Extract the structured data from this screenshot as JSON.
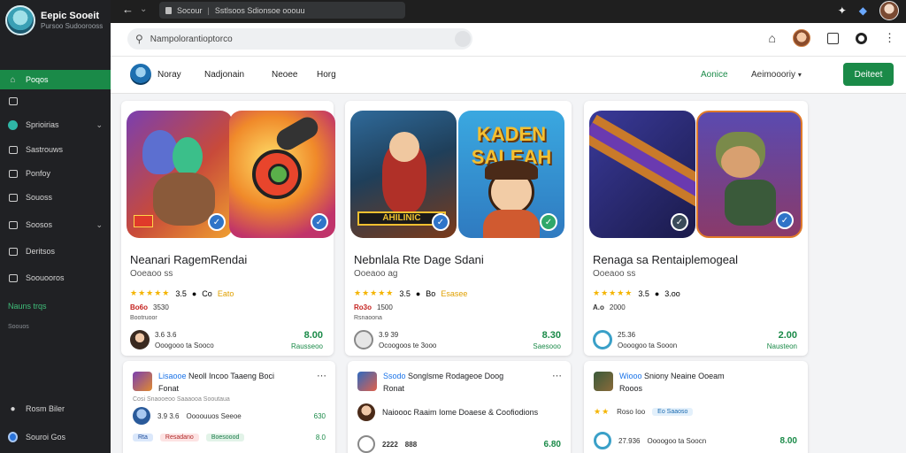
{
  "brand": {
    "title": "Eepic Sooeit",
    "subtitle": "Pursoo Sudoorooss"
  },
  "sidebar": {
    "items": [
      {
        "label": "Poqos",
        "icon": "home-icon"
      },
      {
        "label": "",
        "icon": "inbox-icon"
      },
      {
        "label": "Sprioirias",
        "icon": "globe-icon"
      },
      {
        "label": "Sastrouws",
        "icon": "grid-icon"
      },
      {
        "label": "Ponfoy",
        "icon": "list-icon"
      },
      {
        "label": "Souoss",
        "icon": "window-icon"
      },
      {
        "label": "Soosos",
        "icon": "tray-icon"
      },
      {
        "label": "Deritsos",
        "icon": "folder-icon"
      },
      {
        "label": "Soouooros",
        "icon": "chart-icon"
      },
      {
        "label": "Nauns trqs"
      },
      {
        "label": "Soouos"
      }
    ],
    "bottom": [
      {
        "label": "Rosm Biler",
        "icon": "person-icon"
      },
      {
        "label": "Souroi Gos",
        "icon": "account-icon"
      }
    ]
  },
  "topbar": {
    "tab_label": "Socour",
    "url_text": "Sstlsoos Sdionsoe ooouu"
  },
  "search": {
    "placeholder": "Nampolorantioptorco"
  },
  "tabs": {
    "items": [
      "Noray",
      "Nadjonain",
      "Neoee",
      "Horg"
    ],
    "right_green": "Aonice",
    "right_select": "Aeimoooriy",
    "button": "Deiteet"
  },
  "cards": [
    {
      "title": "Neanari RagemRendai",
      "subtitle": "Ooeaoo ss",
      "rating": "3.5",
      "rating_extra": "Co",
      "rating_tag": "Eato",
      "meta_red": "Bo6o",
      "meta_plain": "3530",
      "meta_small": "Bootruoor",
      "foot_a": "3.6 3.6",
      "foot_b": "Ooogooo ta Sooco",
      "price": "8.00",
      "price_sub": "Rausseoo",
      "art_label": "",
      "colors": {
        "a": "#b24a2e",
        "b": "#e79c2f",
        "icon": "#f7d23c"
      }
    },
    {
      "title": "Nebnlala Rte Dage Sdani",
      "subtitle": "Ooeaoo ag",
      "rating": "3.5",
      "rating_extra": "Bo",
      "rating_tag": "Esasee",
      "meta_red": "Ro3o",
      "meta_plain": "1500",
      "meta_small": "Rsnaoona",
      "foot_a": "3.9 39",
      "foot_b": "Ocoogoos te 3ooo",
      "price": "8.30",
      "price_sub": "Saesooo",
      "art_label": "KADEN SALEAH",
      "art_label_2": "AHILINIC",
      "colors": {
        "a": "#2f78c8",
        "b": "#e8c34a",
        "icon": "#e04b2c"
      }
    },
    {
      "title": "Renaga sa Rentaiplemogeal",
      "subtitle": "Ooeaoo ss",
      "rating": "3.5",
      "rating_extra": "3.oo",
      "meta_red": "A.o",
      "meta_plain": "2000",
      "foot_a": "25.36",
      "foot_b": "Oooogoo ta Sooon",
      "price": "2.00",
      "price_sub": "Nausteon",
      "colors": {
        "a": "#2a2f7a",
        "b": "#b94a2b",
        "icon": "#3aa0c8"
      }
    }
  ],
  "lower_cards": [
    {
      "title_blue": "Lisaooe",
      "title_rest": "Neoll Incoo Taaeng Boci",
      "sub": "Fonat",
      "row1": "Cosi Snaooeoo  Saaaooa Sooutaua",
      "row2_a": "3.9 3.6",
      "row2_b": "Oooouuos Seeoe",
      "row2_price": "630",
      "row3_tag1": "Rta",
      "row3_tag2": "Resadano",
      "row3_tag3": "Boesoood",
      "row3_price": "8.0"
    },
    {
      "title_blue": "Ssodo",
      "title_rest": "Songlsme Rodageoe Doog",
      "sub": "Ronat",
      "row1": "Naioooc Raaim Iome  Doaese & Coofiodions",
      "row2_a": "2222",
      "row2_b": "888",
      "row2_price": "6.80"
    },
    {
      "title_blue": "Wiooo",
      "title_rest": "Sniony Neaine Ooeam",
      "sub": "Rooos",
      "row1_rating": "Roso Ioo",
      "row1_tag": "Eo Saaoso",
      "row2_a": "27.936",
      "row2_b": "Oooogoo ta Soocn",
      "row2_price": "8.00"
    }
  ],
  "accent": "#1a8a48"
}
